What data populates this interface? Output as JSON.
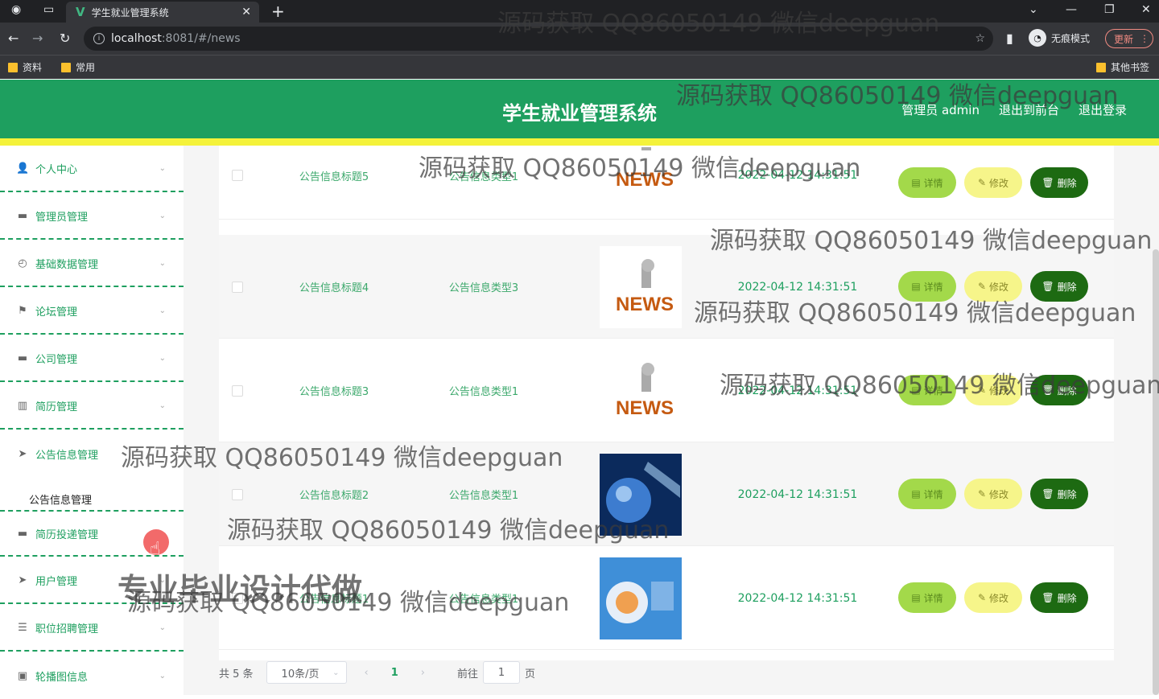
{
  "browser": {
    "tab_title": "学生就业管理系统",
    "url_host": "localhost",
    "url_path": ":8081/#/news",
    "incognito_label": "无痕模式",
    "update_label": "更新",
    "bookmarks": [
      "资料",
      "常用"
    ],
    "other_bookmarks": "其他书签"
  },
  "header": {
    "title": "学生就业管理系统",
    "user_label": "管理员 admin",
    "front_link": "退出到前台",
    "logout_link": "退出登录"
  },
  "sidebar": {
    "items": [
      {
        "label": "个人中心",
        "icon": "user-icon"
      },
      {
        "label": "管理员管理",
        "icon": "monitor-icon"
      },
      {
        "label": "基础数据管理",
        "icon": "compass-icon"
      },
      {
        "label": "论坛管理",
        "icon": "flag-icon"
      },
      {
        "label": "公司管理",
        "icon": "monitor-icon"
      },
      {
        "label": "简历管理",
        "icon": "bar-chart-icon"
      },
      {
        "label": "公告信息管理",
        "icon": "send-icon"
      },
      {
        "label": "简历投递管理",
        "icon": "monitor-icon"
      },
      {
        "label": "用户管理",
        "icon": "send-icon"
      },
      {
        "label": "职位招聘管理",
        "icon": "list-icon"
      },
      {
        "label": "轮播图信息",
        "icon": "chat-icon"
      }
    ],
    "active_submenu": "公告信息管理"
  },
  "table": {
    "rows": [
      {
        "title": "公告信息标题5",
        "type": "公告信息类型1",
        "image": "news-image",
        "time": "2022-04-12 14:31:51"
      },
      {
        "title": "公告信息标题4",
        "type": "公告信息类型3",
        "image": "news-image",
        "time": "2022-04-12 14:31:51"
      },
      {
        "title": "公告信息标题3",
        "type": "公告信息类型1",
        "image": "news-image",
        "time": "2022-04-12 14:31:51"
      },
      {
        "title": "公告信息标题2",
        "type": "公告信息类型1",
        "image": "globe-image",
        "time": "2022-04-12 14:31:51"
      },
      {
        "title": "公告信息标题1",
        "type": "公告信息类型1",
        "image": "globe-image",
        "time": "2022-04-12 14:31:51"
      }
    ],
    "actions": {
      "detail": "详情",
      "edit": "修改",
      "delete": "删除"
    }
  },
  "pagination": {
    "total": "共 5 条",
    "page_size": "10条/页",
    "current_page": "1",
    "goto_label": "前往",
    "goto_value": "1",
    "page_suffix": "页"
  },
  "watermark": {
    "text": "源码获取 QQ86050149 微信deepguan",
    "big_text": "专业毕业设计代做"
  }
}
